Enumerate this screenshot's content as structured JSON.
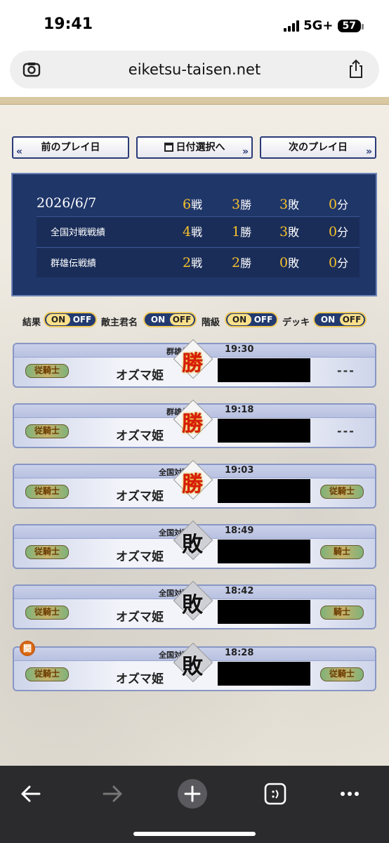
{
  "status": {
    "time": "19:41",
    "network": "5G+",
    "battery": "57"
  },
  "browser": {
    "url": "eiketsu-taisen.net"
  },
  "nav": {
    "prev": "前のプレイ日",
    "date_select": "日付選択へ",
    "next": "次のプレイ日"
  },
  "summary": {
    "date": "2026/6/7",
    "total": {
      "battles": "6",
      "wins": "3",
      "losses": "3",
      "draws": "0"
    },
    "rows": [
      {
        "label": "全国対戦戦績",
        "battles": "4",
        "wins": "1",
        "losses": "3",
        "draws": "0"
      },
      {
        "label": "群雄伝戦績",
        "battles": "2",
        "wins": "2",
        "losses": "0",
        "draws": "0"
      }
    ],
    "units": {
      "battle": "戦",
      "win": "勝",
      "loss": "敗",
      "draw": "分"
    }
  },
  "toggles": [
    {
      "label": "結果",
      "on": "ON",
      "off": "OFF",
      "state": "on"
    },
    {
      "label": "敵主君名",
      "on": "ON",
      "off": "OFF",
      "state": "off"
    },
    {
      "label": "階級",
      "on": "ON",
      "off": "OFF",
      "state": "on"
    },
    {
      "label": "デッキ",
      "on": "ON",
      "off": "OFF",
      "state": "off"
    }
  ],
  "matches": [
    {
      "mode": "群雄伝",
      "time": "19:30",
      "player": "オズマ姫",
      "result": "勝",
      "opponent_rank": "---",
      "my_rank": "従騎士"
    },
    {
      "mode": "群雄伝",
      "time": "19:18",
      "player": "オズマ姫",
      "result": "勝",
      "opponent_rank": "---",
      "my_rank": "従騎士"
    },
    {
      "mode": "全国対戦",
      "time": "19:03",
      "player": "オズマ姫",
      "result": "勝",
      "opponent_rank": "従騎士",
      "my_rank": "従騎士"
    },
    {
      "mode": "全国対戦",
      "time": "18:49",
      "player": "オズマ姫",
      "result": "敗",
      "opponent_rank": "騎士",
      "my_rank": "従騎士"
    },
    {
      "mode": "全国対戦",
      "time": "18:42",
      "player": "オズマ姫",
      "result": "敗",
      "opponent_rank": "騎士",
      "my_rank": "従騎士"
    },
    {
      "mode": "全国対戦",
      "time": "18:28",
      "player": "オズマ姫",
      "result": "敗",
      "opponent_rank": "従騎士",
      "my_rank": "従騎士",
      "icon": "闘"
    }
  ]
}
